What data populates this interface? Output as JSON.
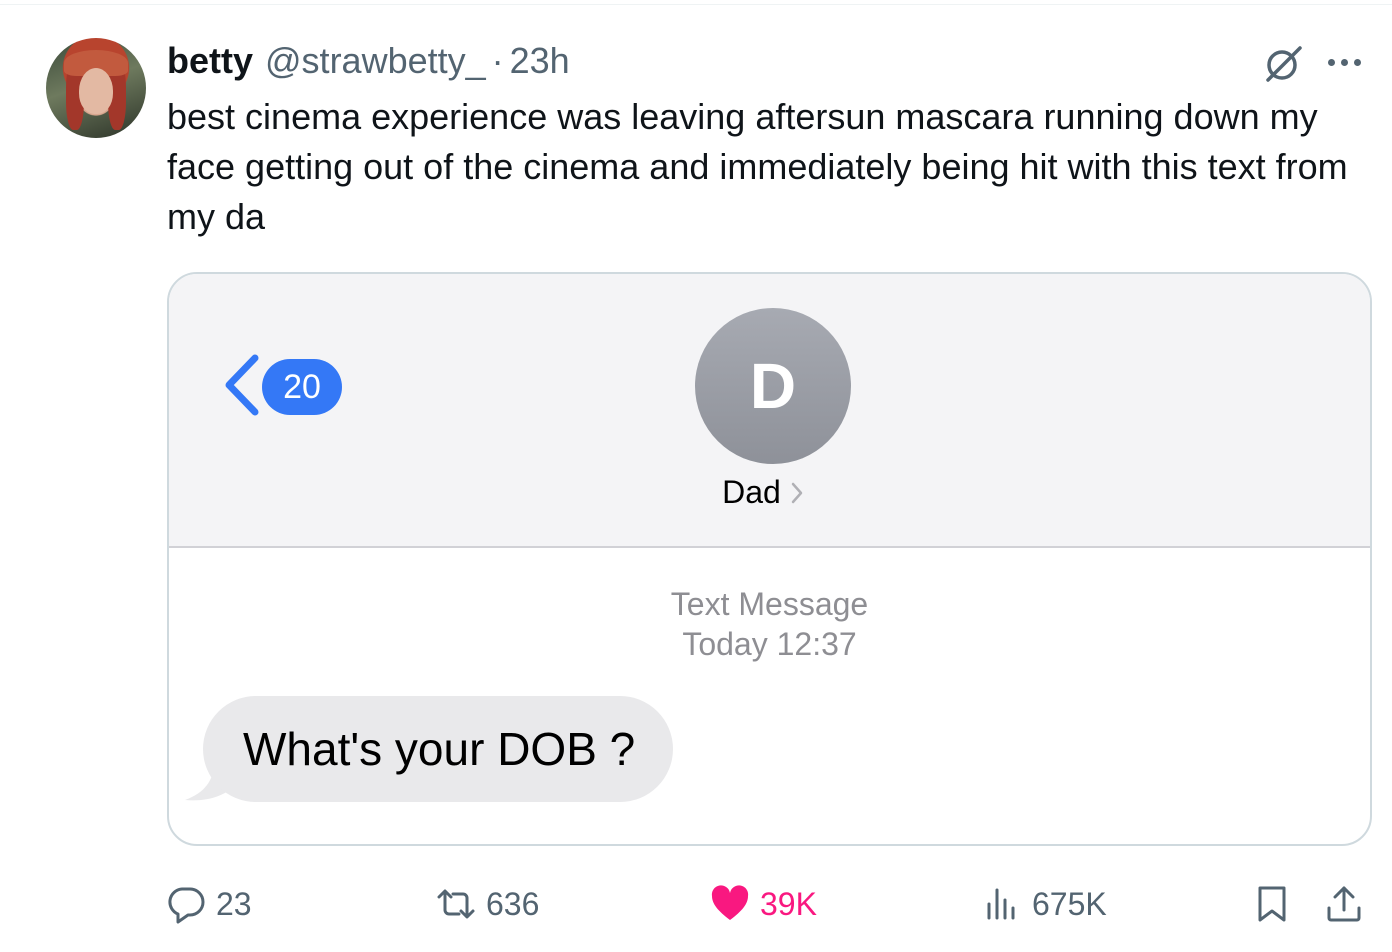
{
  "author": {
    "name": "betty",
    "handle": "@strawbetty_",
    "separator": "·",
    "time": "23h"
  },
  "tweet": {
    "text": "best cinema experience was leaving aftersun mascara running down my face getting out of the cinema and immediately being hit with this text from my da"
  },
  "header_icons": [
    "grok-icon",
    "more-icon"
  ],
  "screenshot": {
    "unread_count": "20",
    "contact_initial": "D",
    "contact_name": "Dad",
    "message_type": "Text Message",
    "message_time": "Today 12:37",
    "message_text": "What's your DOB ?",
    "colors": {
      "badge_blue": "#3478f6",
      "bubble_gray": "#e9e9eb",
      "avatar_gray": "#9a9da5"
    }
  },
  "actions": {
    "replies": "23",
    "reposts": "636",
    "likes": "39K",
    "views": "675K"
  },
  "colors": {
    "like_pink": "#f91880",
    "secondary_text": "#536471",
    "border": "#cfd9de"
  }
}
